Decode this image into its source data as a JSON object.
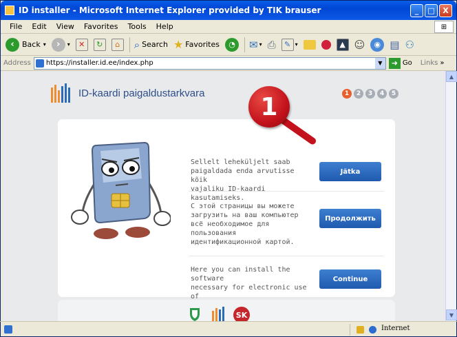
{
  "window": {
    "title": "ID installer - Microsoft Internet Explorer provided by TIK brauser",
    "controls": [
      "_",
      "□",
      "X"
    ]
  },
  "menubar": {
    "items": [
      "File",
      "Edit",
      "View",
      "Favorites",
      "Tools",
      "Help"
    ]
  },
  "toolbar": {
    "back_label": "Back",
    "search_label": "Search",
    "favorites_label": "Favorites"
  },
  "addressbar": {
    "label": "Address",
    "url": "https://installer.id.ee/index.php",
    "go_label": "Go",
    "links_label": "Links",
    "chevron": "»"
  },
  "page": {
    "logo_text": "ID-kaardi paigaldustarkvara",
    "steps": [
      "1",
      "2",
      "3",
      "4",
      "5"
    ],
    "callout_number": "1",
    "sections": [
      {
        "text": "Sellelt leheküljelt saab\npaigaldada enda arvutisse kõik\nvajaliku ID-kaardi kasutamiseks.",
        "button": "Jätka"
      },
      {
        "text": "С этой страницы вы можете\nзагрузить на ваш компьютер\nвсё необходимое для\nпользования\nидентификационной картой.",
        "button": "Продолжить"
      },
      {
        "text": "Here you can install the software\nnecessary for electronic use of\nthe ID-card.",
        "button": "Continue"
      }
    ],
    "footer_badge": "SK"
  },
  "statusbar": {
    "zone": "Internet"
  },
  "colors": {
    "titlebar": "#0a5ee8",
    "button": "#2a66bc",
    "accent_orange": "#e8602c",
    "callout_red": "#c4121c"
  }
}
